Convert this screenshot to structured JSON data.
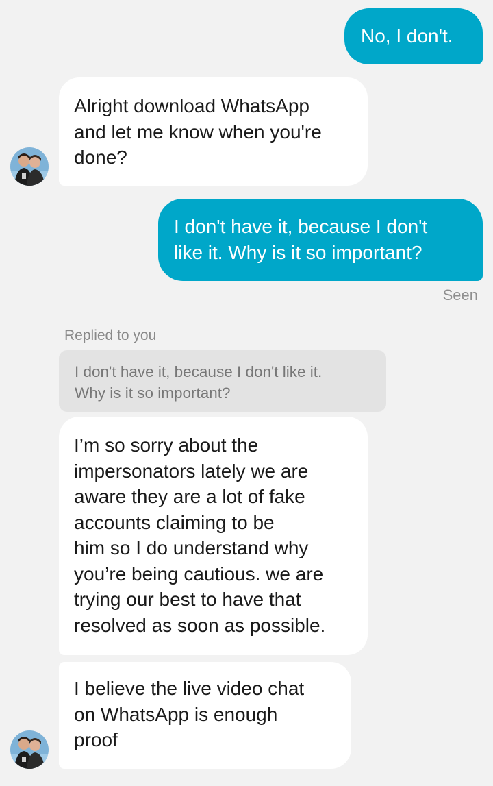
{
  "messages": [
    {
      "id": "m1",
      "direction": "outgoing",
      "text": "No, I don't."
    },
    {
      "id": "m2",
      "direction": "incoming",
      "text": "Alright download WhatsApp\nand let me know when you're\ndone?"
    },
    {
      "id": "m3",
      "direction": "outgoing",
      "text": "I don't have it, because I don't\nlike it.  Why is it so important?"
    },
    {
      "id": "m4",
      "direction": "incoming",
      "text": "I’m so sorry about the\nimpersonators lately we are\naware they are a lot of fake\naccounts claiming to be\nhim so I do understand why\nyou’re being cautious. we are\ntrying our best to have that\nresolved as soon as possible."
    },
    {
      "id": "m5",
      "direction": "incoming",
      "text": "I believe the live video chat\non WhatsApp is enough\nproof"
    }
  ],
  "seen_label": "Seen",
  "reply_context": {
    "label": "Replied to you",
    "quoted_text": "I don't have it, because I don't like it.\nWhy is it so important?"
  },
  "colors": {
    "outgoing_bubble": "#00a7c9",
    "incoming_bubble": "#ffffff",
    "background": "#f2f2f2",
    "quote_bubble": "#e3e3e3"
  },
  "icons": {
    "avatar": "contact-avatar-photo"
  }
}
